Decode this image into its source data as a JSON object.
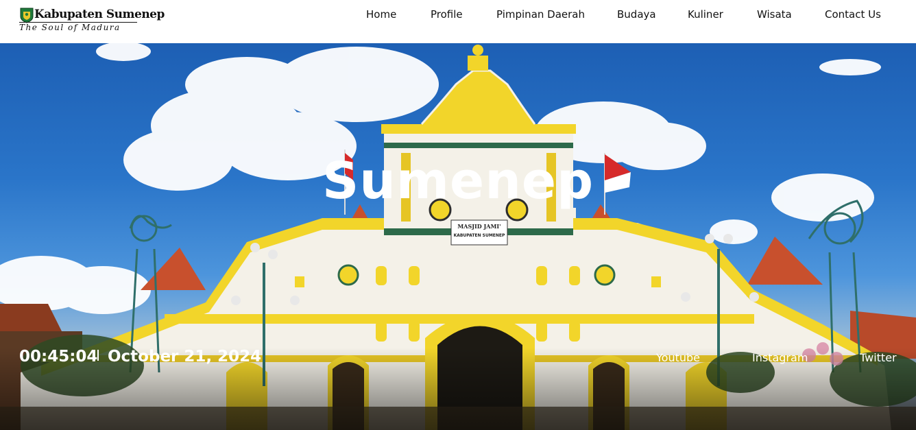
{
  "logo": {
    "title": "Kabupaten Sumenep",
    "subtitle": "The Soul of Madura"
  },
  "nav": {
    "items": [
      "Home",
      "Profile",
      "Pimpinan Daerah",
      "Budaya",
      "Kuliner",
      "Wisata",
      "Contact Us"
    ]
  },
  "hero": {
    "title": "Sumenep",
    "mosque_sign_line1": "MASJID JAMI'",
    "mosque_sign_line2": "KABUPATEN SUMENEP"
  },
  "status": {
    "time": "00:45:04",
    "date": "October 21, 2024"
  },
  "social": {
    "youtube": "Youtube",
    "instagram": "Instagram",
    "twitter": "Twitter"
  },
  "colors": {
    "sky": "#2a75c9",
    "mosque_yellow": "#f2d52a",
    "mosque_white": "#f4f1e8",
    "roof_red": "#c8502d"
  }
}
